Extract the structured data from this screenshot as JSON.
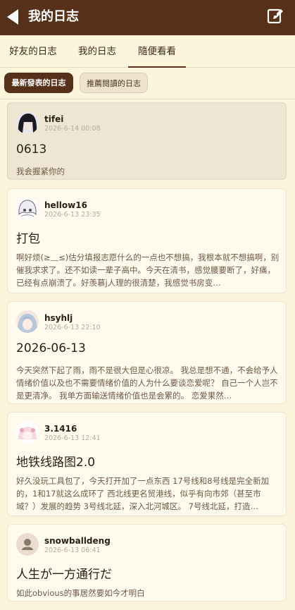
{
  "header": {
    "title": "我的日志",
    "back_icon": "back-arrow-icon",
    "edit_icon": "edit-icon"
  },
  "tabs": [
    {
      "label": "好友的日志",
      "active": false
    },
    {
      "label": "我的日志",
      "active": false
    },
    {
      "label": "隨便看看",
      "active": true
    }
  ],
  "filters": [
    {
      "label": "最新發表的日志",
      "active": true
    },
    {
      "label": "推薦閱讀的日志",
      "active": false
    }
  ],
  "posts": [
    {
      "user": "tifei",
      "time": "2026-6-14 00:08",
      "title": "0613",
      "body": "我会握紧你的",
      "avatar": "anime-avatar-dark-hair"
    },
    {
      "user": "hellow16",
      "time": "2026-6-13 23:35",
      "title": "打包",
      "body": "啊好烦(≥﹏≤)估分填报志愿什么的一点也不想搞，我根本就不想搞啊，别催我求求了。还不如读一辈子高中。今天在清书，感觉腰要断了，好痛，已经有点崩溃了。好羡慕j人理的很清楚，我感觉书房变…",
      "avatar": "anime-avatar-white-hair"
    },
    {
      "user": "hsyhlj",
      "time": "2026-6-13 22:10",
      "title": "2026-06-13",
      "body": "今天突然下起了雨，雨不是很大但是心很凉。 我总是想不通，不会给予人情绪价值以及也不需要情绪价值的人为什么要谈恋爱呢？ 自己一个人岂不是更清净。 我单方面输送情绪价值也是会累的。 恋爱果然…",
      "avatar": "anime-avatar-pastel"
    },
    {
      "user": "3.1416",
      "time": "2026-6-13 12:41",
      "title": "地铁线路图2.0",
      "body": "好久没玩工具包了，今天打开加了一点东西 17号线和8号线是完全新加的，1和17就这么成环了 西北线更名贸港线，似乎有向市郊（甚至市域？）发展的趋势 3号线北延，深入北河城区。 7号线北延，打造…",
      "avatar": "anime-avatar-pink"
    },
    {
      "user": "snowballdeng",
      "time": "2026-6-13 06:41",
      "title": "人生が一方通行だ",
      "body": "如此obvious的事居然要如今才明白",
      "avatar": "default-user-icon"
    }
  ],
  "colors": {
    "appbar": "#563019",
    "background": "#fdf4dc",
    "card": "#fffaee",
    "card_highlight": "#eee6d2"
  }
}
